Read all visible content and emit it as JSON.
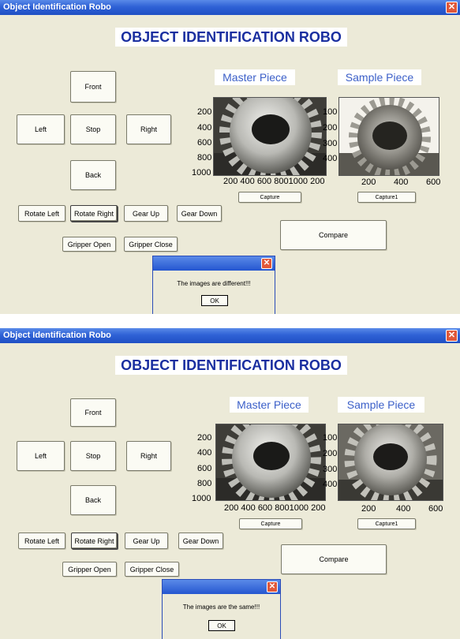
{
  "window_title": "Object Identification Robo",
  "heading": "OBJECT IDENTIFICATION ROBO",
  "buttons": {
    "front": "Front",
    "left": "Left",
    "stop": "Stop",
    "right": "Right",
    "back": "Back",
    "rotate_left": "Rotate Left",
    "rotate_right": "Rotate Right",
    "gear_up": "Gear Up",
    "gear_down": "Gear Down",
    "gripper_open": "Gripper Open",
    "gripper_close": "Gripper Close",
    "capture": "Capture",
    "capture1": "Capture1",
    "compare": "Compare"
  },
  "master": {
    "label": "Master Piece",
    "y_ticks": [
      "200",
      "400",
      "600",
      "800",
      "1000"
    ],
    "x_ticks_top": "200 400 600 8001000 200",
    "x_ticks_bottom": "200 400 600 8001000 200"
  },
  "sample": {
    "label": "Sample Piece",
    "y_ticks": [
      "100",
      "200",
      "300",
      "400"
    ],
    "x_ticks": [
      "200",
      "400",
      "600"
    ]
  },
  "dialog_top": {
    "message": "The images are different!!!",
    "ok": "OK"
  },
  "dialog_bottom": {
    "message": "The images are the same!!!",
    "ok": "OK"
  }
}
